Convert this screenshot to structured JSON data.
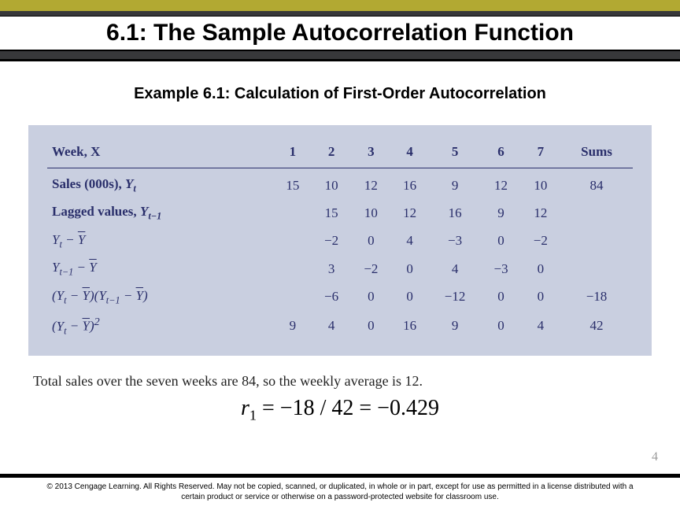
{
  "title": "6.1: The Sample Autocorrelation Function",
  "subtitle": "Example 6.1: Calculation of First-Order Autocorrelation",
  "table": {
    "head": {
      "rowlabel": "Week, X",
      "cols": [
        "1",
        "2",
        "3",
        "4",
        "5",
        "6",
        "7"
      ],
      "sums": "Sums"
    },
    "rows": {
      "r1": {
        "label_html": "Sales (000s), <i>Y<span class='sub'>t</span></i>",
        "vals": [
          "15",
          "10",
          "12",
          "16",
          "9",
          "12",
          "10"
        ],
        "sum": "84"
      },
      "r2": {
        "label_html": "Lagged values, <i>Y<span class='sub'>t−1</span></i>",
        "vals": [
          "",
          "15",
          "10",
          "12",
          "16",
          "9",
          "12"
        ],
        "sum": ""
      },
      "r3": {
        "label_html": "<i>Y<span class='sub'>t</span></i> − <span class='ybar'><i>Y</i></span>",
        "vals": [
          "",
          "−2",
          "0",
          "4",
          "−3",
          "0",
          "−2"
        ],
        "sum": ""
      },
      "r4": {
        "label_html": "<i>Y<span class='sub'>t−1</span></i> − <span class='ybar'><i>Y</i></span>",
        "vals": [
          "",
          "3",
          "−2",
          "0",
          "4",
          "−3",
          "0"
        ],
        "sum": ""
      },
      "r5": {
        "label_html": "(<i>Y<span class='sub'>t</span></i> − <span class='ybar'><i>Y</i></span>)(<i>Y<span class='sub'>t−1</span></i> − <span class='ybar'><i>Y</i></span>)",
        "vals": [
          "",
          "−6",
          "0",
          "0",
          "−12",
          "0",
          "0"
        ],
        "sum": "−18"
      },
      "r6": {
        "label_html": "(<i>Y<span class='sub'>t</span></i> − <span class='ybar'><i>Y</i></span>)<sup>2</sup>",
        "vals": [
          "9",
          "4",
          "0",
          "16",
          "9",
          "0",
          "4"
        ],
        "sum": "42"
      }
    }
  },
  "note": "Total sales over the seven weeks are 84, so the weekly average is 12.",
  "equation_html": "<i>r</i><span class='esub'>1</span> = −18 / 42 = −0.429",
  "pagenum": "4",
  "copyright": "© 2013 Cengage Learning. All Rights Reserved. May not be copied, scanned, or duplicated, in whole or in part, except for use as permitted in a license distributed with a certain product or service or otherwise on a password-protected website for classroom use.",
  "chart_data": {
    "type": "table",
    "title": "Example 6.1: Calculation of First-Order Autocorrelation",
    "columns": [
      "Week, X",
      "1",
      "2",
      "3",
      "4",
      "5",
      "6",
      "7",
      "Sums"
    ],
    "rows": [
      {
        "label": "Sales (000s), Y_t",
        "values": [
          15,
          10,
          12,
          16,
          9,
          12,
          10
        ],
        "sum": 84
      },
      {
        "label": "Lagged values, Y_{t-1}",
        "values": [
          null,
          15,
          10,
          12,
          16,
          9,
          12
        ],
        "sum": null
      },
      {
        "label": "Y_t - Ȳ",
        "values": [
          null,
          -2,
          0,
          4,
          -3,
          0,
          -2
        ],
        "sum": null
      },
      {
        "label": "Y_{t-1} - Ȳ",
        "values": [
          null,
          3,
          -2,
          0,
          4,
          -3,
          0
        ],
        "sum": null
      },
      {
        "label": "(Y_t - Ȳ)(Y_{t-1} - Ȳ)",
        "values": [
          null,
          -6,
          0,
          0,
          -12,
          0,
          0
        ],
        "sum": -18
      },
      {
        "label": "(Y_t - Ȳ)^2",
        "values": [
          9,
          4,
          0,
          16,
          9,
          0,
          4
        ],
        "sum": 42
      }
    ],
    "result": {
      "r1": -0.429,
      "numerator": -18,
      "denominator": 42
    }
  }
}
